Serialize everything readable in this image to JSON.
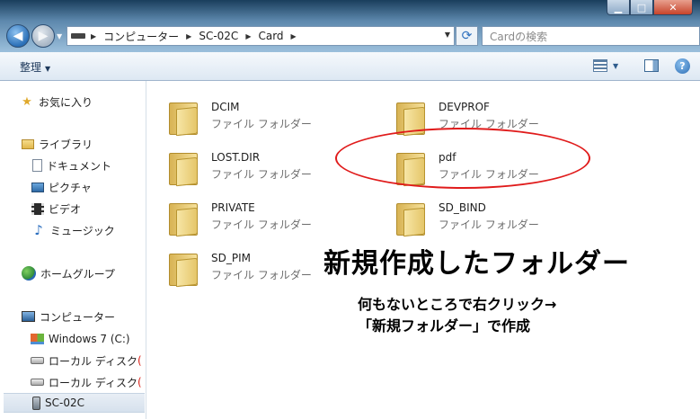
{
  "window": {
    "controls": {
      "minimize": "▁",
      "maximize": "□",
      "close": "✕"
    }
  },
  "address_bar": {
    "back_icon": "back-arrow-icon",
    "forward_icon": "forward-arrow-icon",
    "segments": [
      "コンピューター",
      "SC-02C",
      "Card"
    ],
    "search_placeholder": "Cardの検索"
  },
  "command_bar": {
    "organize_label": "整理",
    "help_label": "?"
  },
  "navigation": {
    "favorites": "お気に入り",
    "libraries": "ライブラリ",
    "library_items": [
      "ドキュメント",
      "ピクチャ",
      "ビデオ",
      "ミュージック"
    ],
    "homegroup": "ホームグループ",
    "computer": "コンピューター",
    "drives": [
      "Windows 7 (C:)",
      "ローカル ディスク",
      "ローカル ディスク",
      "SC-02C"
    ],
    "truncated_marker": "("
  },
  "folders": [
    {
      "name": "DCIM",
      "type": "ファイル フォルダー"
    },
    {
      "name": "DEVPROF",
      "type": "ファイル フォルダー"
    },
    {
      "name": "LOST.DIR",
      "type": "ファイル フォルダー"
    },
    {
      "name": "pdf",
      "type": "ファイル フォルダー"
    },
    {
      "name": "PRIVATE",
      "type": "ファイル フォルダー"
    },
    {
      "name": "SD_BIND",
      "type": "ファイル フォルダー"
    },
    {
      "name": "SD_PIM",
      "type": "ファイル フォルダー"
    }
  ],
  "annotations": {
    "headline": "新規作成したフォルダー",
    "line1": "何もないところで右クリック→",
    "line2": "「新規フォルダー」で作成",
    "highlight_color": "#e01b1b"
  }
}
